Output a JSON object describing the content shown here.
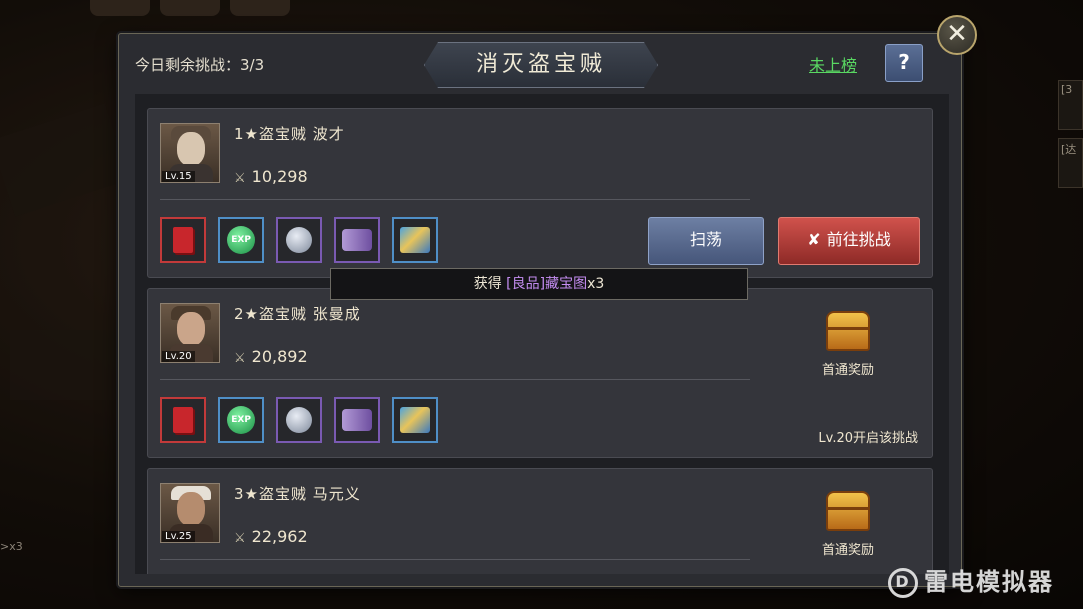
{
  "header": {
    "remaining_label": "今日剩余挑战：3/3",
    "title": "消灭盗宝贼",
    "rank_link": "未上榜",
    "help_label": "?",
    "close_label": "✕"
  },
  "bosses": [
    {
      "name": "1★盗宝贼 波才",
      "level_badge": "Lv.15",
      "power": "10,298",
      "sweep_label": "扫荡",
      "challenge_label": "前往挑战"
    },
    {
      "name": "2★盗宝贼 张曼成",
      "level_badge": "Lv.20",
      "power": "20,892",
      "first_clear_label": "首通奖励",
      "unlock_text": "Lv.20开启该挑战"
    },
    {
      "name": "3★盗宝贼 马元义",
      "level_badge": "Lv.25",
      "power": "22,962",
      "first_clear_label": "首通奖励"
    }
  ],
  "reward_items": [
    {
      "icon": "red-book-icon",
      "quality": "red"
    },
    {
      "icon": "exp-orb-icon",
      "quality": "blue",
      "label": "EXP"
    },
    {
      "icon": "silver-coin-icon",
      "quality": "purple"
    },
    {
      "icon": "purple-scroll-icon",
      "quality": "purple"
    },
    {
      "icon": "treasure-map-icon",
      "quality": "blue"
    }
  ],
  "tooltip": {
    "prefix": "获得",
    "item": "[良品]藏宝图",
    "suffix": "x3"
  },
  "background": {
    "bottom_left_text": ">x3",
    "right_tabs": [
      "[3",
      "[达"
    ]
  },
  "watermark": {
    "logo_text": "D",
    "text": "雷电模拟器"
  },
  "colors": {
    "rank_link": "#59d862",
    "quality_purple_text": "#c38cf0",
    "challenge_button": "#b03c37",
    "sweep_button": "#5a6b90"
  }
}
